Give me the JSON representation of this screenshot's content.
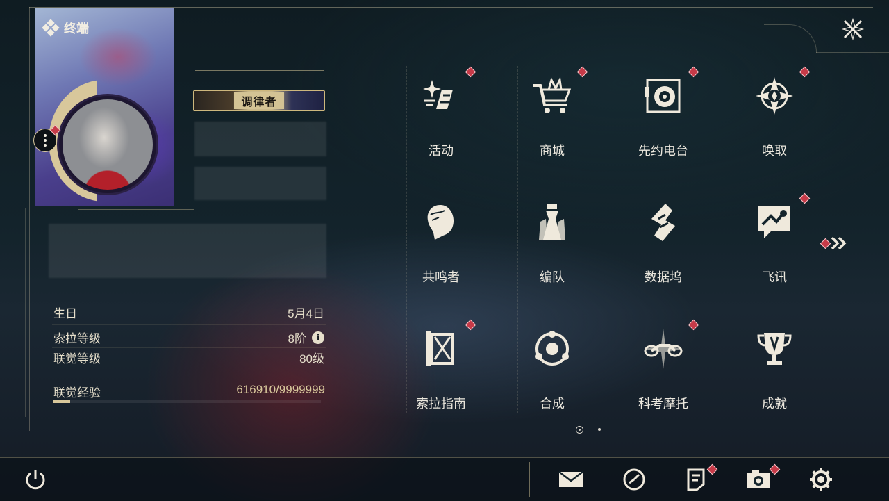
{
  "header": {
    "title": "终端"
  },
  "profile": {
    "title_badge": "调律者",
    "stats": [
      {
        "label": "生日",
        "value": "5月4日"
      },
      {
        "label": "索拉等级",
        "value": "8阶"
      },
      {
        "label": "联觉等级",
        "value": "80级"
      }
    ],
    "exp": {
      "label": "联觉经验",
      "value": "616910/9999999",
      "fraction": 0.0617
    }
  },
  "menu": {
    "items": [
      {
        "label": "活动",
        "icon": "activity-sparkle-icon",
        "badge": true
      },
      {
        "label": "商城",
        "icon": "shop-cart-icon",
        "badge": true
      },
      {
        "label": "先约电台",
        "icon": "radio-icon",
        "badge": true
      },
      {
        "label": "唤取",
        "icon": "compass-star-icon",
        "badge": true
      },
      {
        "label": "共鸣者",
        "icon": "resonator-head-icon",
        "badge": false
      },
      {
        "label": "编队",
        "icon": "chess-team-icon",
        "badge": false
      },
      {
        "label": "数据坞",
        "icon": "data-dock-icon",
        "badge": false
      },
      {
        "label": "飞讯",
        "icon": "chat-message-icon",
        "badge": true
      },
      {
        "label": "索拉指南",
        "icon": "guide-book-icon",
        "badge": true
      },
      {
        "label": "合成",
        "icon": "synthesis-icon",
        "badge": false
      },
      {
        "label": "科考摩托",
        "icon": "motorcycle-icon",
        "badge": true
      },
      {
        "label": "成就",
        "icon": "trophy-icon",
        "badge": false
      }
    ],
    "page": {
      "current": 1,
      "total": 2
    }
  },
  "bottom": {
    "icons": [
      "power-icon",
      "mail-icon",
      "clock-icon",
      "notice-icon",
      "camera-icon",
      "settings-gear-icon"
    ]
  },
  "colors": {
    "accent": "#d8c79b",
    "badge_red": "#c63a48",
    "text": "#ece8de"
  }
}
